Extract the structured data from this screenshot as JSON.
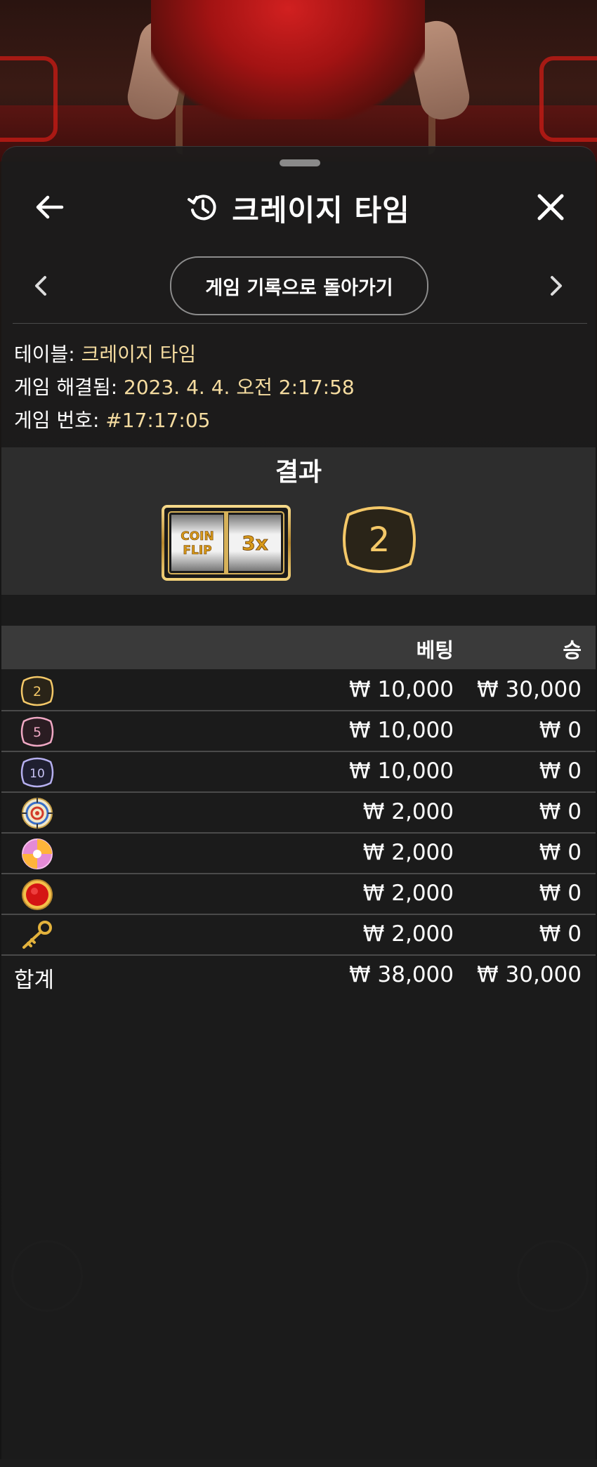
{
  "header": {
    "title": "크레이지 타임"
  },
  "nav": {
    "back_to_history_label": "게임 기록으로 돌아가기"
  },
  "info": {
    "table_label": "테이블:",
    "table_value": "크레이지 타임",
    "resolved_label": "게임 해결됨:",
    "resolved_value": "2023. 4. 4. 오전 2:17:58",
    "game_no_label": "게임 번호:",
    "game_no_value": "#17:17:05"
  },
  "result": {
    "title": "결과",
    "slot_left": "COIN FLIP",
    "slot_right": "3x",
    "number": "2"
  },
  "table": {
    "col_bet": "베팅",
    "col_win": "승",
    "rows": [
      {
        "icon": "number-2-icon",
        "label": "2",
        "bet": "₩ 10,000",
        "win": "₩ 30,000"
      },
      {
        "icon": "number-5-icon",
        "label": "5",
        "bet": "₩ 10,000",
        "win": "₩ 0"
      },
      {
        "icon": "number-10-icon",
        "label": "10",
        "bet": "₩ 10,000",
        "win": "₩ 0"
      },
      {
        "icon": "cash-hunt-icon",
        "bet": "₩ 2,000",
        "win": "₩ 0"
      },
      {
        "icon": "pachinko-icon",
        "bet": "₩ 2,000",
        "win": "₩ 0"
      },
      {
        "icon": "coin-flip-icon",
        "bet": "₩ 2,000",
        "win": "₩ 0"
      },
      {
        "icon": "crazy-time-key-icon",
        "bet": "₩ 2,000",
        "win": "₩ 0"
      }
    ],
    "total_label": "합계",
    "total_bet": "₩ 38,000",
    "total_win": "₩ 30,000"
  },
  "colors": {
    "accent_gold": "#f4c868",
    "info_value": "#f5dca0",
    "panel_bg": "#1c1c1c"
  }
}
